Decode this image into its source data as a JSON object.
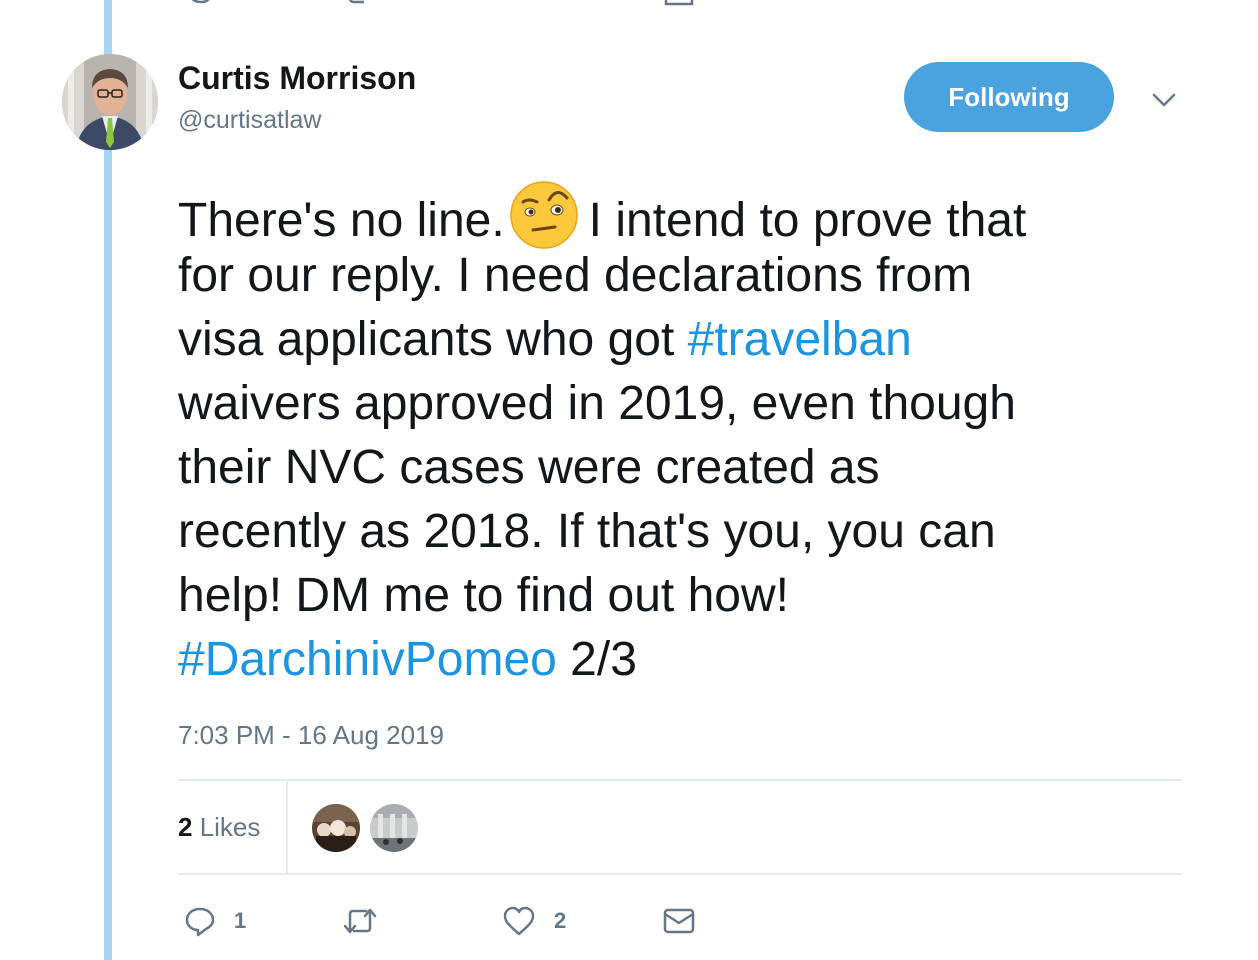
{
  "tweet": {
    "author": {
      "display_name": "Curtis Morrison",
      "handle": "@curtisatlaw",
      "avatar_icon": "profile-photo"
    },
    "follow_button_label": "Following",
    "menu_icon": "chevron-down-icon",
    "text_lines": {
      "line1_a": "There's no line.",
      "line1_emoji": "face-with-raised-eyebrow-emoji",
      "line1_b": "I intend to prove that",
      "line2": "for our reply. I need declarations from",
      "line3_a": "visa applicants who got ",
      "line3_hashtag": "#travelban",
      "line4": "waivers approved in 2019, even though",
      "line5": "their NVC cases were created as",
      "line6": "recently as 2018. If that's you, you can",
      "line7": "help! DM me to find out how!",
      "line8_hashtag": "#DarchinivPomeo",
      "line8_b": " 2/3"
    },
    "timestamp": "7:03 PM - 16 Aug 2019",
    "likes": {
      "count": "2",
      "label": " Likes"
    },
    "actions": {
      "reply_count": "1",
      "retweet_count": "",
      "like_count": "2"
    }
  },
  "colors": {
    "accent": "#1b95e0",
    "follow_bg": "#4aa3df",
    "thread_line": "#a8d4f3",
    "muted_text": "#657786"
  }
}
